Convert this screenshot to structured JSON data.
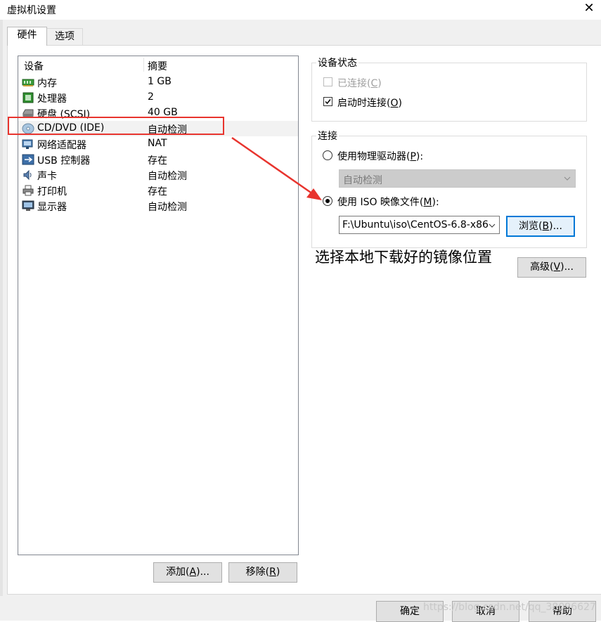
{
  "window": {
    "title": "虚拟机设置",
    "close_glyph": "✕"
  },
  "tabs": [
    {
      "label": "硬件",
      "active": true
    },
    {
      "label": "选项",
      "active": false
    }
  ],
  "device_list": {
    "columns": [
      "设备",
      "摘要"
    ],
    "rows": [
      {
        "icon": "memory-icon",
        "name": "内存",
        "summary": "1 GB"
      },
      {
        "icon": "processor-icon",
        "name": "处理器",
        "summary": "2"
      },
      {
        "icon": "hard-disk-icon",
        "name": "硬盘 (SCSI)",
        "summary": "40 GB"
      },
      {
        "icon": "cd-dvd-icon",
        "name": "CD/DVD (IDE)",
        "summary": "自动检测",
        "selected": true
      },
      {
        "icon": "network-adapter-icon",
        "name": "网络适配器",
        "summary": "NAT"
      },
      {
        "icon": "usb-icon",
        "name": "USB 控制器",
        "summary": "存在"
      },
      {
        "icon": "sound-card-icon",
        "name": "声卡",
        "summary": "自动检测"
      },
      {
        "icon": "printer-icon",
        "name": "打印机",
        "summary": "存在"
      },
      {
        "icon": "display-icon",
        "name": "显示器",
        "summary": "自动检测"
      }
    ]
  },
  "left_buttons": {
    "add": {
      "label": "添加(",
      "key": "A",
      "suffix": ")..."
    },
    "remove": {
      "label": "移除(",
      "key": "R",
      "suffix": ")"
    }
  },
  "device_status": {
    "title": "设备状态",
    "connected": {
      "label": "已连接(",
      "key": "C",
      "suffix": ")",
      "checked": false,
      "enabled": false
    },
    "connect_at_power_on": {
      "label": "启动时连接(",
      "key": "O",
      "suffix": ")",
      "checked": true,
      "enabled": true
    }
  },
  "connection": {
    "title": "连接",
    "physical_drive": {
      "label": "使用物理驱动器(",
      "key": "P",
      "suffix": "):",
      "selected": false
    },
    "physical_drive_value": "自动检测",
    "iso_image": {
      "label": "使用 ISO 映像文件(",
      "key": "M",
      "suffix": "):",
      "selected": true
    },
    "iso_path": "F:\\Ubuntu\\iso\\CentOS-6.8-x86",
    "browse": {
      "label": "浏览(",
      "key": "B",
      "suffix": ")..."
    }
  },
  "advanced_button": {
    "label": "高级(",
    "key": "V",
    "suffix": ")..."
  },
  "annotation_note": "选择本地下载好的镜像位置",
  "dialog_buttons": {
    "ok": "确定",
    "cancel": "取消",
    "help": "帮助"
  },
  "watermark": "https://blog.csdn.net/qq_38096627",
  "colors": {
    "highlight_box": "#e8342e",
    "arrow": "#e8342e",
    "focus_blue": "#0078d7"
  }
}
